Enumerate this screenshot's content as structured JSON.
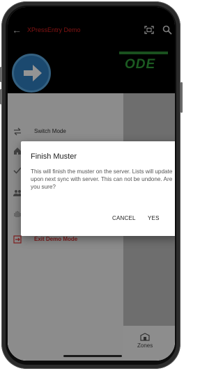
{
  "app_bar": {
    "title": "XPressEntry Demo",
    "back_icon": "arrow-back-icon",
    "scan_icon": "qr-scan-icon",
    "search_icon": "search-icon",
    "title_color": "#dd2222"
  },
  "hero": {
    "logo_text": "ODE",
    "logo_color": "#2f9e3a",
    "arrow_color": "#2f7fc0"
  },
  "drawer": {
    "items": [
      {
        "label": "Switch Mode",
        "icon": "swap-icon"
      },
      {
        "label": "",
        "icon": "home-icon"
      },
      {
        "label": "",
        "icon": "check-icon"
      },
      {
        "label": "",
        "icon": "people-icon"
      },
      {
        "label": "",
        "icon": "fingerprint-icon"
      },
      {
        "label": "Exit Demo Mode",
        "icon": "exit-icon"
      }
    ]
  },
  "bottom_nav": {
    "zones_label": "Zones",
    "zones_icon": "building-icon"
  },
  "dialog": {
    "title": "Finish Muster",
    "message": "This will finish the muster on the server. Lists will update upon next sync with server. This can not be undone. Are you sure?",
    "cancel_label": "CANCEL",
    "yes_label": "YES"
  }
}
